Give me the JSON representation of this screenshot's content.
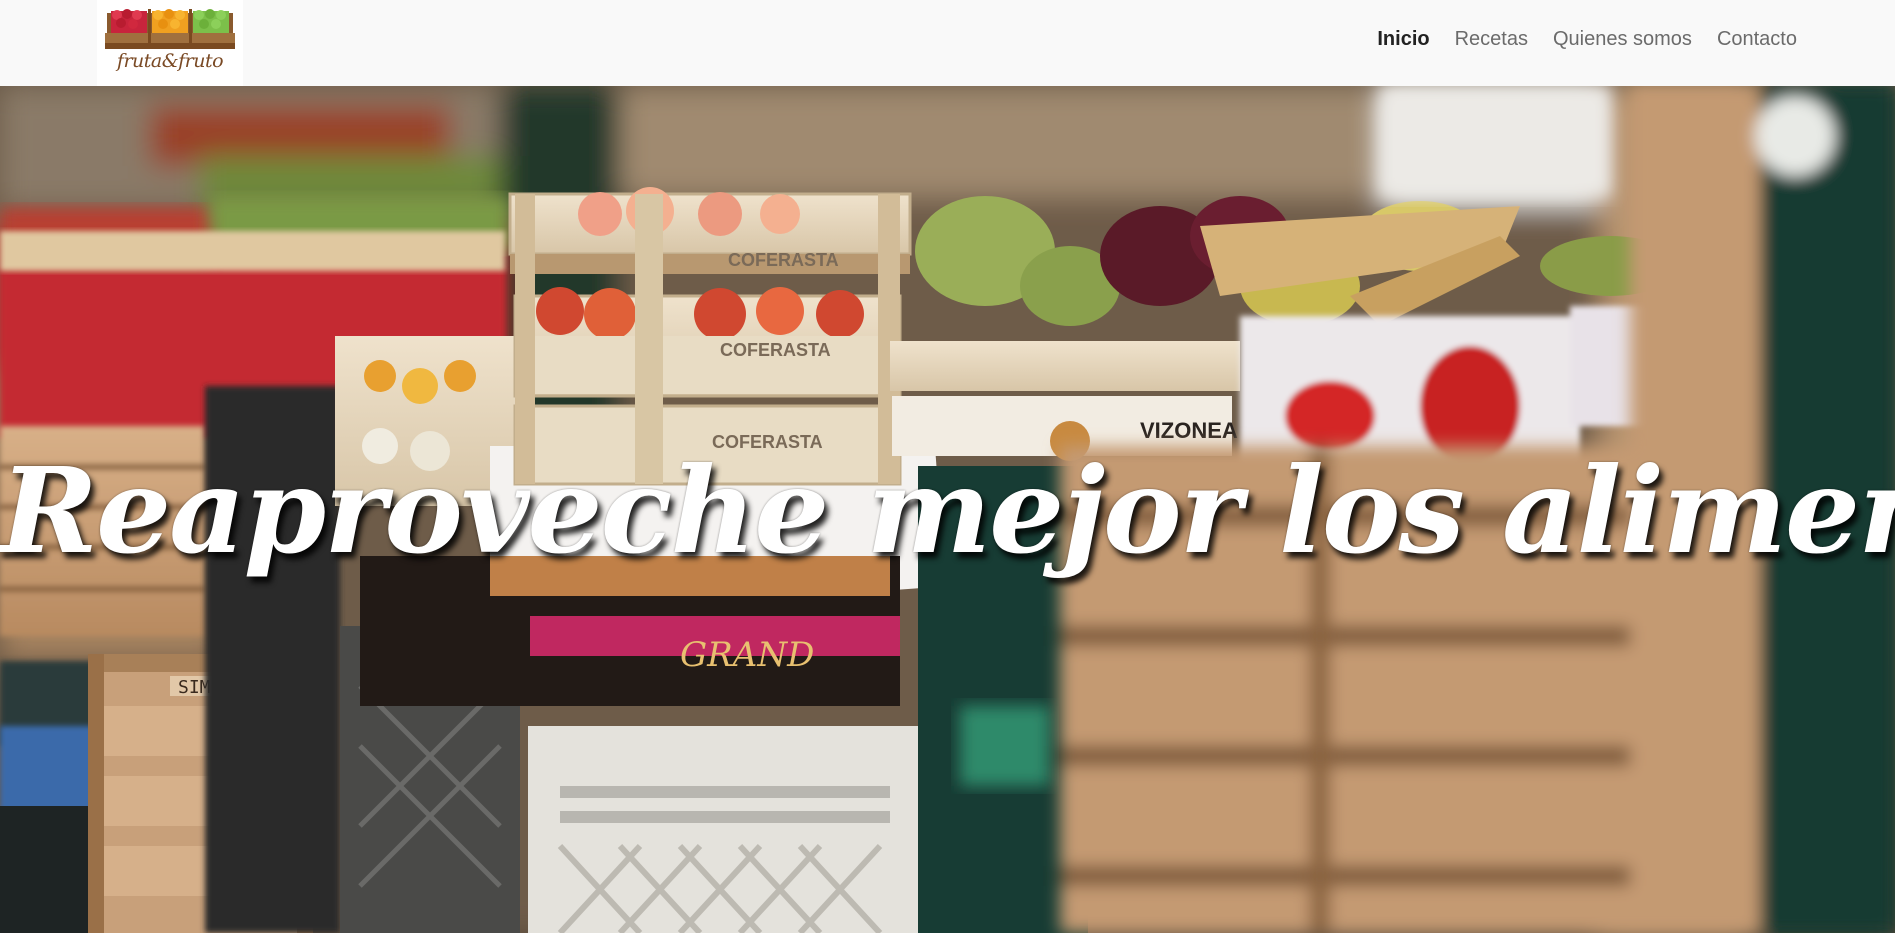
{
  "brand": {
    "logo_text": "fruta&fruto",
    "crate_colors": [
      "#c8243c",
      "#f0a020",
      "#7cc04a"
    ],
    "crate_wood": "#a0703e"
  },
  "nav": {
    "items": [
      {
        "label": "Inicio",
        "active": true
      },
      {
        "label": "Recetas",
        "active": false
      },
      {
        "label": "Quienes somos",
        "active": false
      },
      {
        "label": "Contacto",
        "active": false
      }
    ]
  },
  "hero": {
    "title": "Reaproveche mejor los alimentos",
    "crate_stamp": "COFERASTA",
    "box_label_left": "SIMONE",
    "box_label_grand": "GRAND",
    "box_label_right": "VIZONEA"
  }
}
